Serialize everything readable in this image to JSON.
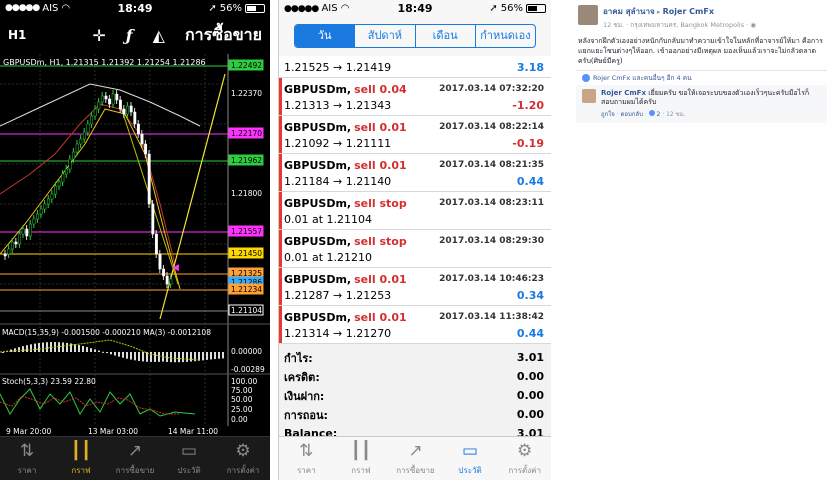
{
  "status": {
    "carrier": "AIS",
    "time": "18:49",
    "battery": "56%",
    "battery_level": 0.56
  },
  "chart_screen": {
    "timeframe": "H1",
    "trade_label": "การซื้อขาย",
    "symbol_info": "GBPUSDm, H1, 1.21315 1.21392 1.21254 1.21286",
    "price_levels": [
      {
        "value": "1.22492",
        "color": "#2ecc40",
        "boxed": true
      },
      {
        "value": "1.22370",
        "color": "#ffffff",
        "boxed": false
      },
      {
        "value": "1.22170",
        "color": "#ff33ff",
        "boxed": true
      },
      {
        "value": "1.21962",
        "color": "#2ecc40",
        "boxed": true
      },
      {
        "value": "1.21800",
        "color": "#ffffff",
        "boxed": false
      },
      {
        "value": "1.21557",
        "color": "#ff33ff",
        "boxed": true
      },
      {
        "value": "1.21450",
        "color": "#ffd700",
        "boxed": true
      },
      {
        "value": "1.21325",
        "color": "#ffa033",
        "boxed": true
      },
      {
        "value": "1.21286",
        "color": "#33aaff",
        "boxed": true
      },
      {
        "value": "1.21234",
        "color": "#ffa033",
        "boxed": true
      },
      {
        "value": "1.21104",
        "color": "#ffffff",
        "boxed": true
      }
    ],
    "macd_label": "MACD(15,35,9) -0.001500 -0.000210 MA(3) -0.0012108",
    "macd_levels": [
      "0.00000",
      "-0.00289"
    ],
    "stoch_label": "Stoch(5,3,3) 23.59 22.80",
    "stoch_levels": [
      "100.00",
      "75.00",
      "50.00",
      "25.00",
      "0.00"
    ],
    "dates": [
      "9 Mar 20:00",
      "13 Mar 03:00",
      "14 Mar 11:00"
    ]
  },
  "history_screen": {
    "segments": [
      "วัน",
      "สัปดาห์",
      "เดือน",
      "กำหนดเอง"
    ],
    "active_segment": 0,
    "first_row": {
      "prices": "1.21525 → 1.21419",
      "profit": "3.18",
      "profit_sign": "pos"
    },
    "trades": [
      {
        "symbol": "GBPUSDm,",
        "side": "sell 0.04",
        "time": "2017.03.14 07:32:20",
        "prices": "1.21313 → 1.21343",
        "profit": "-1.20",
        "profit_sign": "neg"
      },
      {
        "symbol": "GBPUSDm,",
        "side": "sell 0.01",
        "time": "2017.03.14 08:22:14",
        "prices": "1.21092 → 1.21111",
        "profit": "-0.19",
        "profit_sign": "neg"
      },
      {
        "symbol": "GBPUSDm,",
        "side": "sell 0.01",
        "time": "2017.03.14 08:21:35",
        "prices": "1.21184 → 1.21140",
        "profit": "0.44",
        "profit_sign": "pos"
      },
      {
        "symbol": "GBPUSDm,",
        "side": "sell stop",
        "time": "2017.03.14 08:23:11",
        "prices": "0.01 at 1.21104",
        "profit": "",
        "profit_sign": "pos"
      },
      {
        "symbol": "GBPUSDm,",
        "side": "sell stop",
        "time": "2017.03.14 08:29:30",
        "prices": "0.01 at 1.21210",
        "profit": "",
        "profit_sign": "pos"
      },
      {
        "symbol": "GBPUSDm,",
        "side": "sell 0.01",
        "time": "2017.03.14 10:46:23",
        "prices": "1.21287 → 1.21253",
        "profit": "0.34",
        "profit_sign": "pos"
      },
      {
        "symbol": "GBPUSDm,",
        "side": "sell 0.01",
        "time": "2017.03.14 11:38:42",
        "prices": "1.21314 → 1.21270",
        "profit": "0.44",
        "profit_sign": "pos"
      }
    ],
    "summary": [
      {
        "label": "กำไร:",
        "value": "3.01"
      },
      {
        "label": "เครดิต:",
        "value": "0.00"
      },
      {
        "label": "เงินฝาก:",
        "value": "0.00"
      },
      {
        "label": "การถอน:",
        "value": "0.00"
      },
      {
        "label": "Balance:",
        "value": "3.01"
      }
    ]
  },
  "tabs": [
    {
      "label": "ราคา",
      "icon": "quotes-icon"
    },
    {
      "label": "กราฟ",
      "icon": "chart-icon"
    },
    {
      "label": "การซื้อขาย",
      "icon": "trade-icon"
    },
    {
      "label": "ประวัติ",
      "icon": "history-icon"
    },
    {
      "label": "การตั้งค่า",
      "icon": "settings-icon"
    }
  ],
  "facebook": {
    "author": "อาคม สุลำนาจ",
    "arrow": "▸",
    "target": "Rojer CmFx",
    "meta": "12 ชม. · กรุงเทพมหานคร, Bangkok Metropolis · ",
    "text": "หลังจากฝึกตัวเองอย่างหนักกับกลับมาทำความเข้าใจในหลักที่อาจารย์ให้มา คือการแยกแยะโซนต่างๆให้ออก. เข้าออกอย่างมีเหตุผล มองเห็นแล้วเราจะไม่กลัวตลาดครับ(ศิษย์มีครู)",
    "likes": "Rojer CmFx และคนอื่นๆ อีก 4 คน",
    "comment_author": "Rojer CmFx",
    "comment_text": "เยี่ยมครับ ขอให้เจอระบบของตัวเองเร็วๆนะครับมือไรก็สอบถามผมได้ครับ",
    "comment_like": "ถูกใจ",
    "comment_reply": "ตอบกลับ",
    "comment_likes": "2",
    "comment_time": "12 ชม."
  }
}
